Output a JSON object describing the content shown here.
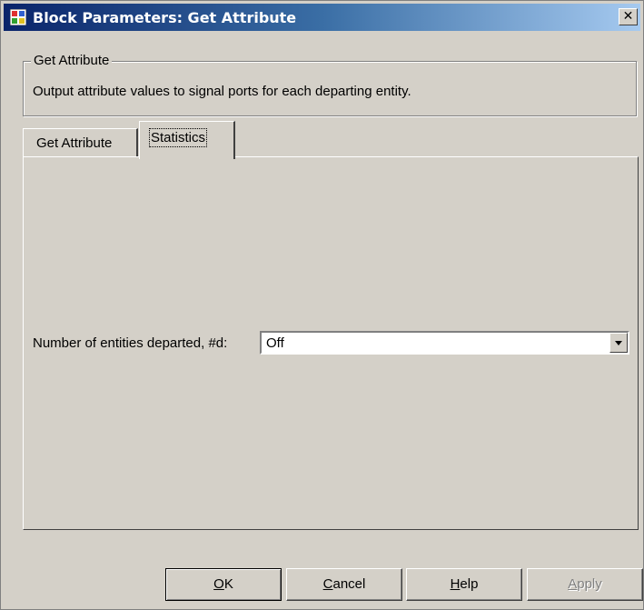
{
  "window": {
    "title": "Block Parameters: Get Attribute",
    "close_label": "✕"
  },
  "group": {
    "legend": "Get Attribute",
    "description": "Output attribute values to signal ports for each departing entity."
  },
  "tabs": [
    {
      "label": "Get Attribute",
      "active": false
    },
    {
      "label": "Statistics",
      "active": true
    }
  ],
  "statistics": {
    "field_label": "Number of entities departed, #d:",
    "selected_value": "Off"
  },
  "buttons": {
    "ok": {
      "mnemonic": "O",
      "rest": "K"
    },
    "cancel": {
      "mnemonic": "C",
      "rest": "ancel"
    },
    "help": {
      "mnemonic": "H",
      "rest": "elp"
    },
    "apply": {
      "mnemonic": "A",
      "rest": "pply",
      "enabled": false
    }
  },
  "colors": {
    "face": "#d4d0c8",
    "title_start": "#0a246a",
    "title_end": "#a6caf0"
  },
  "icons": [
    "simulink-block-icon",
    "close-icon",
    "dropdown-arrow-icon"
  ]
}
